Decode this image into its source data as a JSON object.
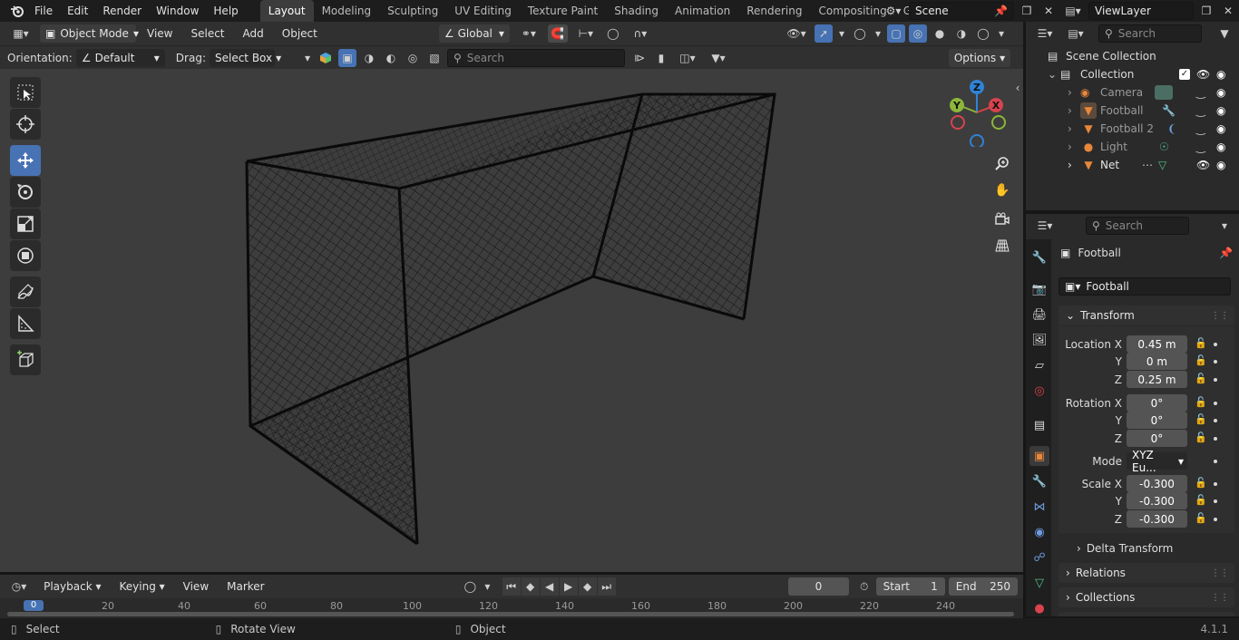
{
  "topbar": {
    "menus": [
      "File",
      "Edit",
      "Render",
      "Window",
      "Help"
    ],
    "workspaces": [
      "Layout",
      "Modeling",
      "Sculpting",
      "UV Editing",
      "Texture Paint",
      "Shading",
      "Animation",
      "Rendering",
      "Compositing",
      "Geomet"
    ],
    "active_workspace": "Layout",
    "scene": "Scene",
    "view_layer": "ViewLayer"
  },
  "viewport": {
    "mode": "Object Mode",
    "menus": [
      "View",
      "Select",
      "Add",
      "Object"
    ],
    "transform_orientation": "Global",
    "orientation_label": "Orientation:",
    "orientation_value": "Default",
    "drag_label": "Drag:",
    "drag_value": "Select Box",
    "search_placeholder": "Search",
    "options_label": "Options",
    "gizmo": {
      "x": "X",
      "y": "Y",
      "z": "Z"
    }
  },
  "outliner": {
    "search_placeholder": "Search",
    "scene_collection": "Scene Collection",
    "collection": "Collection",
    "items": [
      {
        "name": "Camera",
        "icon": "camera-icon"
      },
      {
        "name": "Football",
        "icon": "mesh-icon"
      },
      {
        "name": "Football 2",
        "icon": "mesh-icon"
      },
      {
        "name": "Light",
        "icon": "light-icon"
      },
      {
        "name": "Net",
        "icon": "mesh-icon"
      }
    ]
  },
  "properties": {
    "search_placeholder": "Search",
    "object_name": "Football",
    "object_field": "Football",
    "transform_header": "Transform",
    "location_label": "Location X",
    "location": [
      "0.45 m",
      "0 m",
      "0.25 m"
    ],
    "rotation_label": "Rotation X",
    "rotation": [
      "0°",
      "0°",
      "0°"
    ],
    "mode_label": "Mode",
    "mode_value": "XYZ Eu...",
    "scale_label": "Scale X",
    "scale": [
      "-0.300",
      "-0.300",
      "-0.300"
    ],
    "y_label": "Y",
    "z_label": "Z",
    "delta_transform": "Delta Transform",
    "relations": "Relations",
    "collections": "Collections"
  },
  "timeline": {
    "menus": [
      "Playback",
      "Keying",
      "View",
      "Marker"
    ],
    "current_frame": "0",
    "start_label": "Start",
    "start": "1",
    "end_label": "End",
    "end": "250",
    "ticks": [
      "0",
      "20",
      "40",
      "60",
      "80",
      "100",
      "120",
      "140",
      "160",
      "180",
      "200",
      "220",
      "240"
    ]
  },
  "status": {
    "select": "Select",
    "rotate": "Rotate View",
    "object": "Object",
    "version": "4.1.1"
  },
  "colors": {
    "accent": "#4772b3",
    "x_axis": "#d8434d",
    "y_axis": "#8bb63a",
    "z_axis": "#2f83d6",
    "object_orange": "#e8873a"
  }
}
